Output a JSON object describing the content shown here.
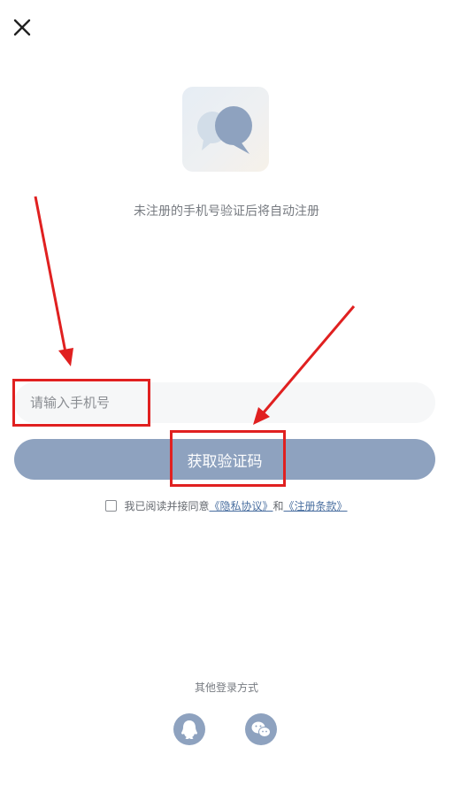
{
  "header": {
    "close_icon": "close-icon"
  },
  "logo": {
    "icon": "chat-bubbles-icon"
  },
  "tip_text": "未注册的手机号验证后将自动注册",
  "phone": {
    "placeholder": "请输入手机号",
    "value": ""
  },
  "get_code_button": "获取验证码",
  "agreement": {
    "prefix": "我已阅读并接同意",
    "privacy_link": "《隐私协议》",
    "and": "和",
    "terms_link": "《注册条款》",
    "checked": false
  },
  "other_login": {
    "label": "其他登录方式",
    "methods": [
      {
        "icon": "qq-icon"
      },
      {
        "icon": "wechat-icon"
      }
    ]
  },
  "colors": {
    "accent": "#8ea2bf",
    "annotation": "#e02020",
    "link": "#4a6fa0"
  }
}
